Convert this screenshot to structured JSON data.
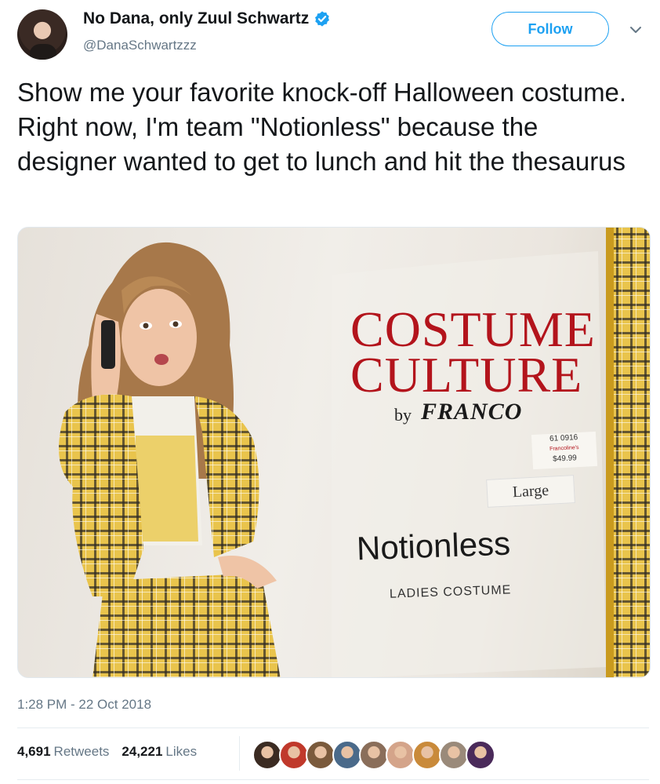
{
  "author": {
    "display_name": "No Dana, only Zuul Schwartz",
    "handle": "@DanaSchwartzzz",
    "verified": true
  },
  "follow_label": "Follow",
  "tweet_text": "Show me your favorite knock-off Halloween costume. Right now, I'm team \"Notionless\" because the designer wanted to get to lunch and hit the thesaurus",
  "media": {
    "brand_line_1": "COSTUME",
    "brand_line_2": "CULTURE",
    "by": "by",
    "maker": "FRANCO",
    "price_tag_code": "61 0916",
    "price_tag_store": "Francoline's",
    "price": "$49.99",
    "size": "Large",
    "product_name": "Notionless",
    "product_sub": "LADIES COSTUME"
  },
  "timestamp": "1:28 PM - 22 Oct 2018",
  "stats": {
    "retweets_count": "4,691",
    "retweets_label": "Retweets",
    "likes_count": "24,221",
    "likes_label": "Likes"
  },
  "liker_avatar_colors": [
    "#3b2b22",
    "#c0392b",
    "#7a5a3c",
    "#4a6a8a",
    "#8a6e5a",
    "#d4a48a",
    "#c98a3a",
    "#9a8a7a",
    "#4a2a5a"
  ],
  "colors": {
    "accent": "#1da1f2",
    "text": "#14171a",
    "secondary": "#657786",
    "brand_red": "#b3141c"
  }
}
